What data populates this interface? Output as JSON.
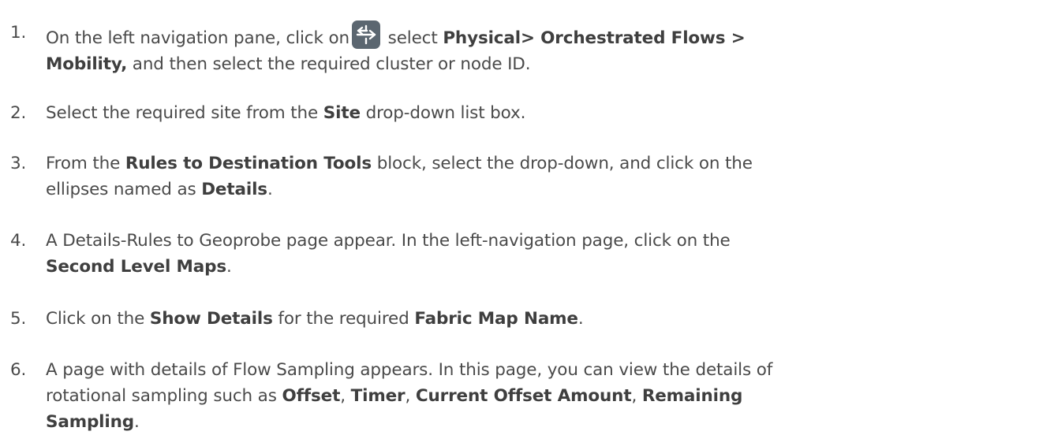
{
  "steps": [
    {
      "number": "1.",
      "text_a": "On the left navigation pane, click on",
      "icon": "flow-nav-icon",
      "text_b": "select",
      "bold_a": "Physical> Orchestrated Flows >",
      "bold_b": "Mobility,",
      "text_c": "and then select the required cluster or node ID."
    },
    {
      "number": "2.",
      "text_a": "Select the required site from the",
      "bold_a": "Site",
      "text_b": "drop-down list box."
    },
    {
      "number": "3.",
      "text_a": "From the",
      "bold_a": "Rules to Destination Tools",
      "text_b": "block, select the drop-down, and click on the",
      "text_c": "ellipses named as",
      "bold_b": "Details",
      "text_d": "."
    },
    {
      "number": "4.",
      "text_a": "A Details-Rules to Geoprobe page appear. In the left-navigation page, click on the",
      "bold_a": "Second Level Maps",
      "text_b": "."
    },
    {
      "number": "5.",
      "text_a": "Click on the",
      "bold_a": "Show Details",
      "text_b": "for the required",
      "bold_b": "Fabric Map Name",
      "text_c": "."
    },
    {
      "number": "6.",
      "text_a": "A page with details of Flow Sampling appears. In this page, you can view the details of",
      "text_b": "rotational sampling such as",
      "bold_a": "Offset",
      "sep_a": ",",
      "bold_b": "Timer",
      "sep_b": ",",
      "bold_c": "Current Offset Amount",
      "sep_c": ",",
      "bold_d": "Remaining",
      "bold_e": "Sampling",
      "text_c": "."
    }
  ],
  "colors": {
    "text": "#4a4a4a",
    "icon_bg": "#5b6670",
    "icon_fg": "#ffffff"
  }
}
